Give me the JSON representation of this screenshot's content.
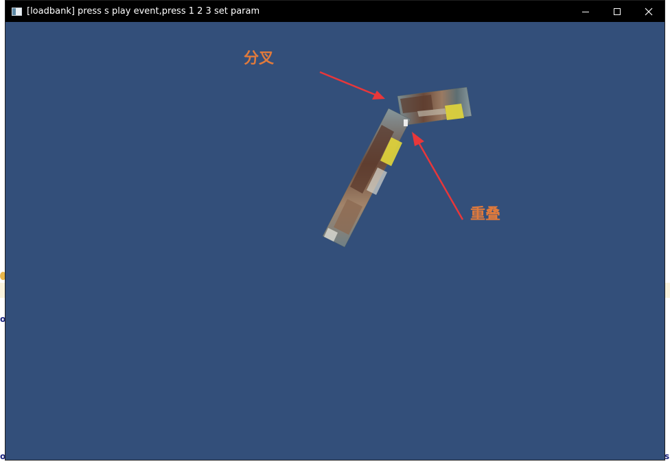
{
  "window": {
    "title": "[loadbank] press s play event,press 1 2 3 set param",
    "background_color": "#334f7a",
    "controls": [
      "minimize-icon",
      "maximize-icon",
      "close-icon"
    ]
  },
  "annotations": {
    "fork_label": "分叉",
    "overlap_label": "重叠",
    "label_color": "#e07a3c",
    "arrow_color": "#e8373a"
  },
  "background_glyphs": {
    "left_top": "o",
    "left_bottom": "o",
    "right_bottom": "s"
  }
}
